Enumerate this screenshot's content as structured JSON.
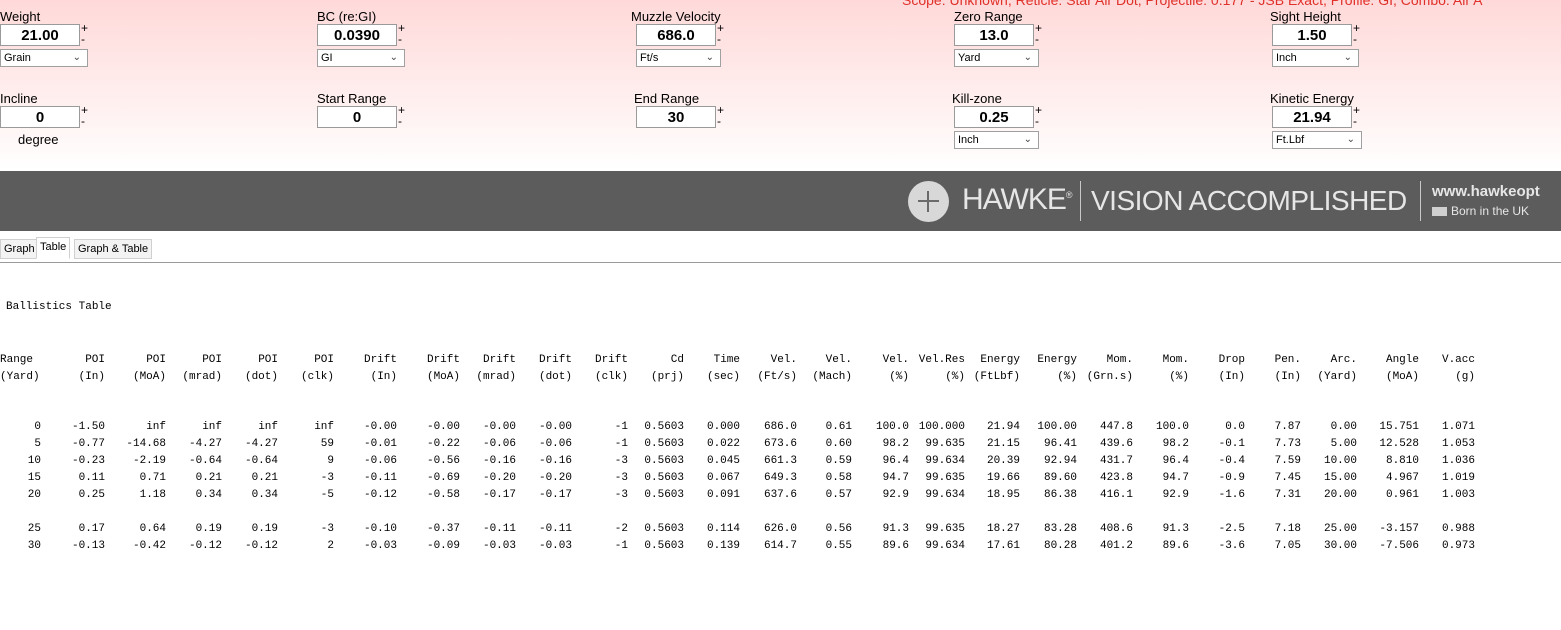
{
  "banner": "Scope: Unknown, Reticle: Star Air Dot, Projectile: 0.177 - JSB Exact, Profile: GI, Combo: Air A",
  "inputs": {
    "weight": {
      "label": "Weight",
      "value": "21.00",
      "unit": "Grain"
    },
    "bc": {
      "label": "BC (re:GI)",
      "value": "0.0390",
      "unit": "GI"
    },
    "muzzle_velocity": {
      "label": "Muzzle Velocity",
      "value": "686.0",
      "unit": "Ft/s"
    },
    "zero_range": {
      "label": "Zero Range",
      "value": "13.0",
      "unit": "Yard"
    },
    "sight_height": {
      "label": "Sight Height",
      "value": "1.50",
      "unit": "Inch"
    },
    "incline": {
      "label": "Incline",
      "value": "0",
      "unit": "degree"
    },
    "start_range": {
      "label": "Start Range",
      "value": "0"
    },
    "end_range": {
      "label": "End Range",
      "value": "30"
    },
    "kill_zone": {
      "label": "Kill-zone",
      "value": "0.25",
      "unit": "Inch"
    },
    "kinetic_energy": {
      "label": "Kinetic Energy",
      "value": "21.94",
      "unit": "Ft.Lbf"
    }
  },
  "spin_plus": "+",
  "spin_minus": "-",
  "brand": {
    "logo": "HAWKE",
    "reg": "®",
    "slogan": "VISION ACCOMPLISHED",
    "url": "www.hawkeopt",
    "born": "Born in the UK"
  },
  "tabs": [
    "Graph",
    "Table",
    "Graph & Table"
  ],
  "active_tab": "Table",
  "table": {
    "title": "Ballistics Table",
    "header1": [
      "Range",
      "POI",
      "POI",
      "POI",
      "POI",
      "POI",
      "Drift",
      "Drift",
      "Drift",
      "Drift",
      "Drift",
      "Cd",
      "Time",
      "Vel.",
      "Vel.",
      "Vel.",
      "Vel.Res",
      "Energy",
      "Energy",
      "Mom.",
      "Mom.",
      "Drop",
      "Pen.",
      "Arc.",
      "Angle",
      "V.acc"
    ],
    "header2": [
      "(Yard)",
      "(In)",
      "(MoA)",
      "(mrad)",
      "(dot)",
      "(clk)",
      "(In)",
      "(MoA)",
      "(mrad)",
      "(dot)",
      "(clk)",
      "(prj)",
      "(sec)",
      "(Ft/s)",
      "(Mach)",
      "(%)",
      "(%)",
      "(FtLbf)",
      "(%)",
      "(Grn.s)",
      "(%)",
      "(In)",
      "(In)",
      "(Yard)",
      "(MoA)",
      "(g)"
    ],
    "groups": [
      [
        [
          "0",
          "-1.50",
          "inf",
          "inf",
          "inf",
          "inf",
          "-0.00",
          "-0.00",
          "-0.00",
          "-0.00",
          "-1",
          "0.5603",
          "0.000",
          "686.0",
          "0.61",
          "100.0",
          "100.000",
          "21.94",
          "100.00",
          "447.8",
          "100.0",
          "0.0",
          "7.87",
          "0.00",
          "15.751",
          "1.071"
        ],
        [
          "5",
          "-0.77",
          "-14.68",
          "-4.27",
          "-4.27",
          "59",
          "-0.01",
          "-0.22",
          "-0.06",
          "-0.06",
          "-1",
          "0.5603",
          "0.022",
          "673.6",
          "0.60",
          "98.2",
          "99.635",
          "21.15",
          "96.41",
          "439.6",
          "98.2",
          "-0.1",
          "7.73",
          "5.00",
          "12.528",
          "1.053"
        ],
        [
          "10",
          "-0.23",
          "-2.19",
          "-0.64",
          "-0.64",
          "9",
          "-0.06",
          "-0.56",
          "-0.16",
          "-0.16",
          "-3",
          "0.5603",
          "0.045",
          "661.3",
          "0.59",
          "96.4",
          "99.634",
          "20.39",
          "92.94",
          "431.7",
          "96.4",
          "-0.4",
          "7.59",
          "10.00",
          "8.810",
          "1.036"
        ],
        [
          "15",
          "0.11",
          "0.71",
          "0.21",
          "0.21",
          "-3",
          "-0.11",
          "-0.69",
          "-0.20",
          "-0.20",
          "-3",
          "0.5603",
          "0.067",
          "649.3",
          "0.58",
          "94.7",
          "99.635",
          "19.66",
          "89.60",
          "423.8",
          "94.7",
          "-0.9",
          "7.45",
          "15.00",
          "4.967",
          "1.019"
        ],
        [
          "20",
          "0.25",
          "1.18",
          "0.34",
          "0.34",
          "-5",
          "-0.12",
          "-0.58",
          "-0.17",
          "-0.17",
          "-3",
          "0.5603",
          "0.091",
          "637.6",
          "0.57",
          "92.9",
          "99.634",
          "18.95",
          "86.38",
          "416.1",
          "92.9",
          "-1.6",
          "7.31",
          "20.00",
          "0.961",
          "1.003"
        ]
      ],
      [
        [
          "25",
          "0.17",
          "0.64",
          "0.19",
          "0.19",
          "-3",
          "-0.10",
          "-0.37",
          "-0.11",
          "-0.11",
          "-2",
          "0.5603",
          "0.114",
          "626.0",
          "0.56",
          "91.3",
          "99.635",
          "18.27",
          "83.28",
          "408.6",
          "91.3",
          "-2.5",
          "7.18",
          "25.00",
          "-3.157",
          "0.988"
        ],
        [
          "30",
          "-0.13",
          "-0.42",
          "-0.12",
          "-0.12",
          "2",
          "-0.03",
          "-0.09",
          "-0.03",
          "-0.03",
          "-1",
          "0.5603",
          "0.139",
          "614.7",
          "0.55",
          "89.6",
          "99.634",
          "17.61",
          "80.28",
          "401.2",
          "89.6",
          "-3.6",
          "7.05",
          "30.00",
          "-7.506",
          "0.973"
        ]
      ]
    ]
  }
}
